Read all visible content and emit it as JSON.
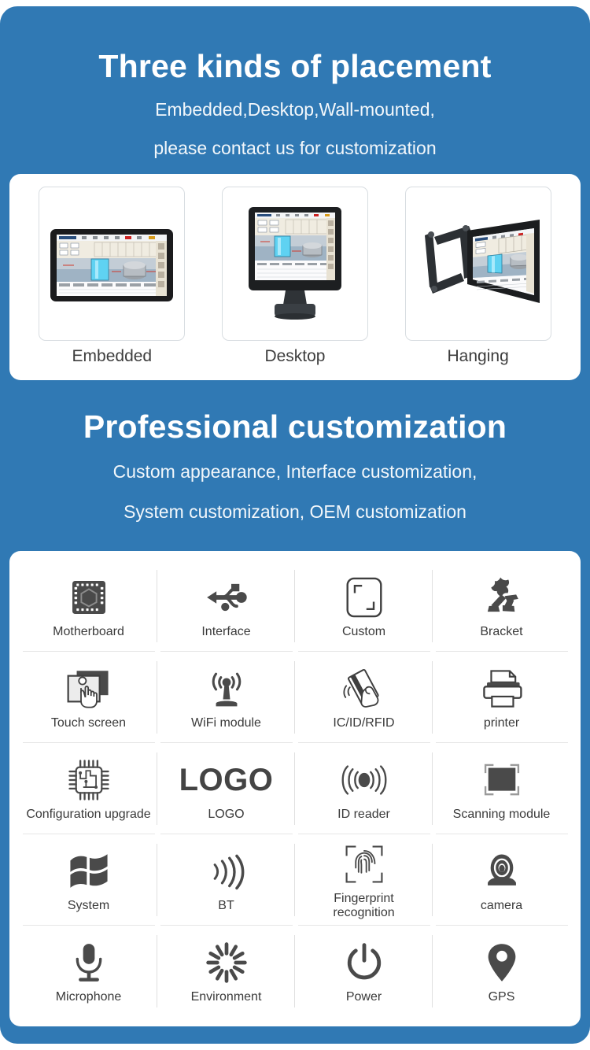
{
  "theme": {
    "brand_blue": "#3079b4",
    "card_white": "#ffffff",
    "icon_dark": "#4a4a4a",
    "text_dark": "#3a3a3a",
    "divider": "#e0e0e0"
  },
  "sections": {
    "placement": {
      "title": "Three kinds of placement",
      "subtitle_line1": "Embedded,Desktop,Wall-mounted,",
      "subtitle_line2": "please contact us for customization",
      "items": [
        {
          "label": "Embedded",
          "icon": "embedded-panel-pc-image"
        },
        {
          "label": "Desktop",
          "icon": "desktop-stand-monitor-image"
        },
        {
          "label": "Hanging",
          "icon": "wall-mount-arm-monitor-image"
        }
      ]
    },
    "customization": {
      "title": "Professional customization",
      "subtitle_line1": "Custom appearance, Interface customization,",
      "subtitle_line2": "System customization, OEM customization",
      "features": [
        {
          "label": "Motherboard",
          "icon": "chip-icon"
        },
        {
          "label": "Interface",
          "icon": "usb-icon"
        },
        {
          "label": "Custom",
          "icon": "custom-frame-icon"
        },
        {
          "label": "Bracket",
          "icon": "vesa-bracket-icon"
        },
        {
          "label": "Touch screen",
          "icon": "touch-hand-icon"
        },
        {
          "label": "WiFi module",
          "icon": "wifi-antenna-icon"
        },
        {
          "label": "IC/ID/RFID",
          "icon": "rfid-card-hand-icon"
        },
        {
          "label": "printer",
          "icon": "printer-icon"
        },
        {
          "label": "Configuration upgrade",
          "icon": "cpu-circuit-icon"
        },
        {
          "label": "LOGO",
          "icon": "logo-text-icon"
        },
        {
          "label": "ID reader",
          "icon": "id-reader-waves-icon"
        },
        {
          "label": "Scanning module",
          "icon": "scanner-bracket-icon"
        },
        {
          "label": "System",
          "icon": "windows-flag-icon"
        },
        {
          "label": "BT",
          "icon": "bluetooth-waves-icon"
        },
        {
          "label": "Fingerprint\nrecognition",
          "icon": "fingerprint-icon"
        },
        {
          "label": "camera",
          "icon": "camera-icon"
        },
        {
          "label": "Microphone",
          "icon": "microphone-icon"
        },
        {
          "label": "Environment",
          "icon": "environment-spinner-icon"
        },
        {
          "label": "Power",
          "icon": "power-icon"
        },
        {
          "label": "GPS",
          "icon": "gps-pin-icon"
        }
      ]
    }
  }
}
